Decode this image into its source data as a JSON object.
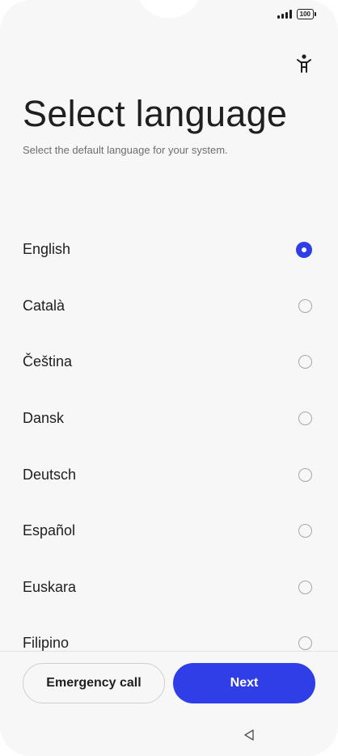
{
  "status_bar": {
    "battery": "100"
  },
  "header": {
    "title": "Select language",
    "subtitle": "Select the default language for your system."
  },
  "languages": [
    {
      "label": "English",
      "selected": true
    },
    {
      "label": "Català",
      "selected": false
    },
    {
      "label": "Čeština",
      "selected": false
    },
    {
      "label": "Dansk",
      "selected": false
    },
    {
      "label": "Deutsch",
      "selected": false
    },
    {
      "label": "Español",
      "selected": false
    },
    {
      "label": "Euskara",
      "selected": false
    },
    {
      "label": "Filipino",
      "selected": false
    }
  ],
  "footer": {
    "emergency_label": "Emergency call",
    "next_label": "Next"
  },
  "icons": {
    "accessibility": "accessibility-icon",
    "back": "back-triangle-icon"
  },
  "colors": {
    "accent": "#2f3ee6"
  }
}
